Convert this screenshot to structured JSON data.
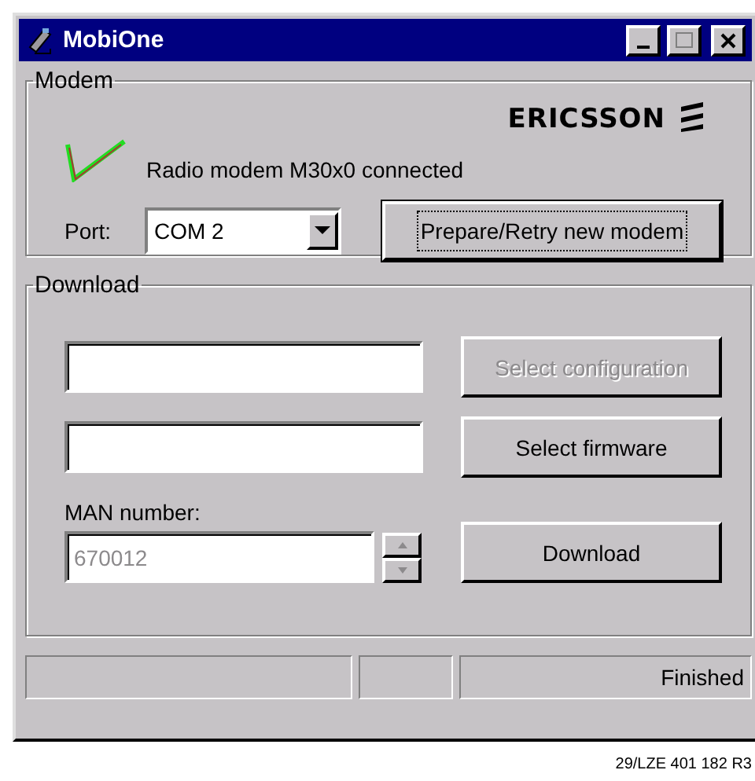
{
  "window": {
    "title": "MobiOne"
  },
  "modem": {
    "label": "Modem",
    "logo": "ERICSSON",
    "connected": true,
    "status": "Radio modem M30x0 connected",
    "port_label": "Port:",
    "port": "COM 2",
    "button": {
      "label": "Prepare/Retry new modem",
      "focused": true
    }
  },
  "download": {
    "label": "Download",
    "rows": [
      {
        "field": "",
        "button": {
          "label": "Select configuration",
          "disabled": true
        }
      },
      {
        "field": "",
        "button": {
          "label": "Select firmware",
          "disabled": false
        }
      }
    ],
    "man_label": "MAN number:",
    "man_value": "670012",
    "man_disabled": true,
    "download_button": "Download"
  },
  "status_bar": {
    "message": "Finished"
  },
  "caption": "29/LZE 401 182 R3"
}
